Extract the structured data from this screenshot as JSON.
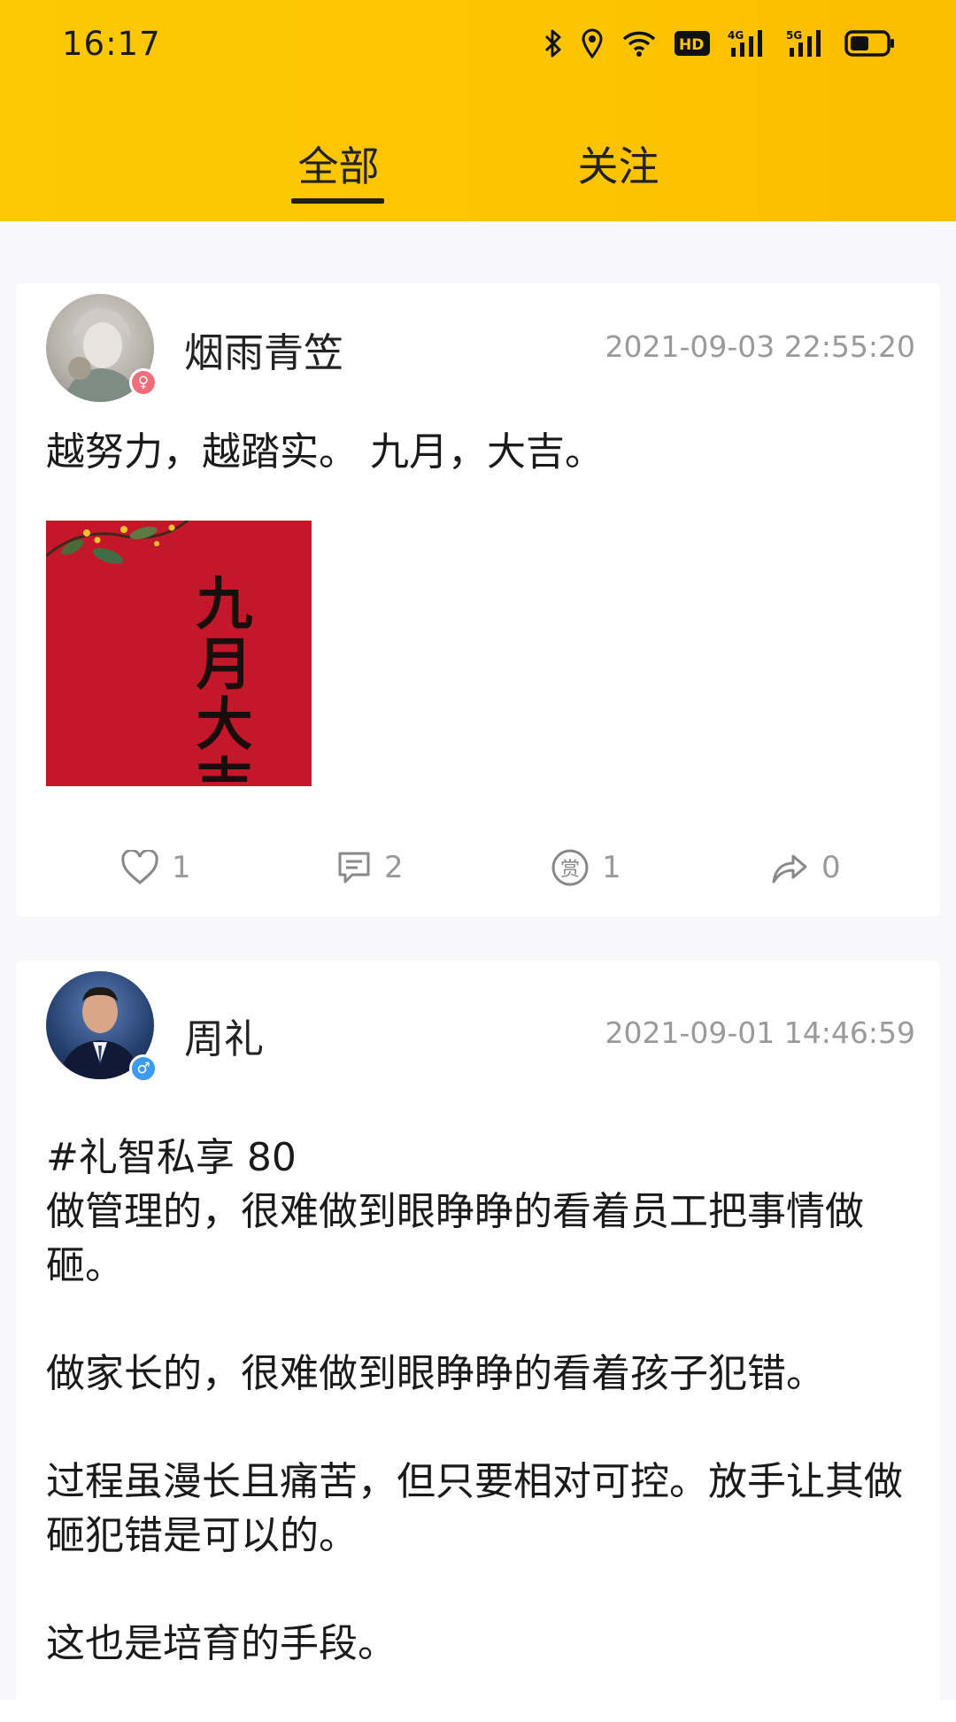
{
  "status_bar": {
    "time": "16:17",
    "icons": [
      "bluetooth-icon",
      "location-icon",
      "wifi-icon",
      "hd-icon",
      "signal-4g-icon",
      "signal-5g-icon",
      "battery-icon"
    ],
    "hd_label": "HD",
    "net1_label": "4G",
    "net2_label": "5G"
  },
  "tabs": [
    {
      "label": "全部",
      "active": true
    },
    {
      "label": "关注",
      "active": false
    }
  ],
  "posts": [
    {
      "username": "烟雨青笠",
      "timestamp": "2021-09-03 22:55:20",
      "text": "越努力，越踏实。 九月，大吉。",
      "image_text": "九月大吉",
      "likes": "1",
      "comments": "2",
      "rewards": "1",
      "shares": "0"
    },
    {
      "username": "周礼",
      "timestamp": "2021-09-01 14:46:59",
      "text": "#礼智私享 80\n做管理的，很难做到眼睁睁的看着员工把事情做砸。\n\n做家长的，很难做到眼睁睁的看着孩子犯错。\n\n过程虽漫长且痛苦，但只要相对可控。放手让其做砸犯错是可以的。\n\n这也是培育的手段。"
    }
  ],
  "reward_icon_char": "赏",
  "colors": {
    "header_yellow": "#fdc702",
    "text_primary": "#1a1a1a",
    "text_secondary": "#9a9a9a",
    "female_badge": "#ee6f7a",
    "male_badge": "#3d9af0",
    "image_red": "#c4172a"
  }
}
